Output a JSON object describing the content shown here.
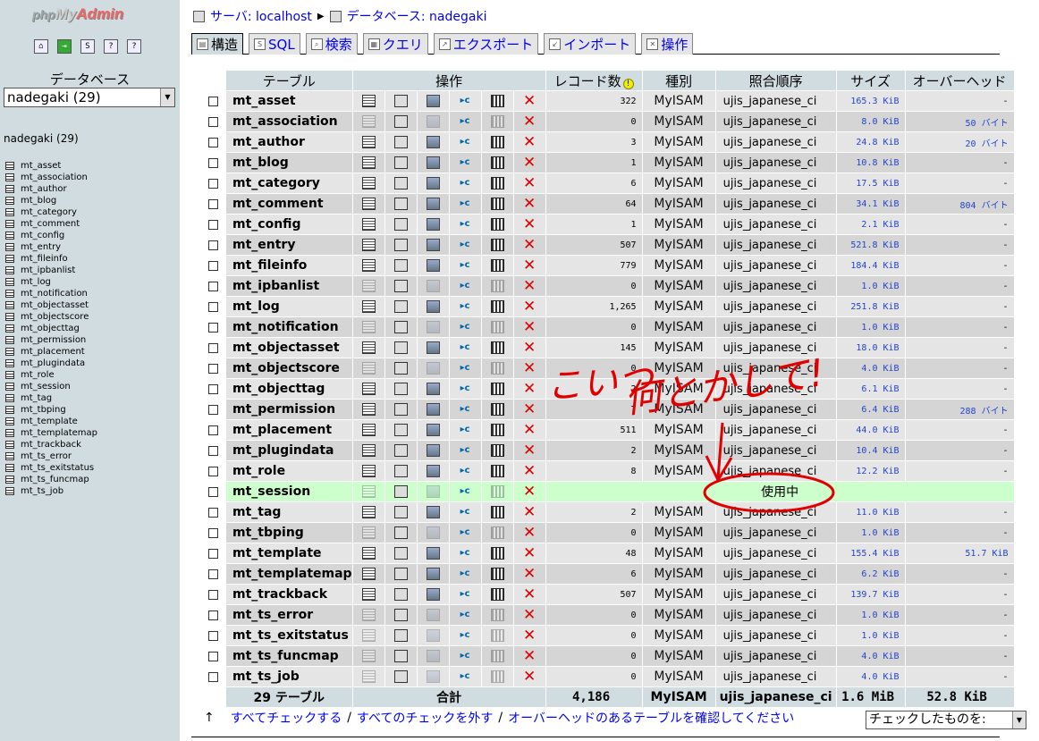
{
  "sidebar": {
    "logo_php": "php",
    "logo_my": "My",
    "logo_admin": "Admin",
    "db_label": "データベース",
    "db_select": "nadegaki (29)",
    "db_name": "nadegaki (29)",
    "tables": [
      "mt_asset",
      "mt_association",
      "mt_author",
      "mt_blog",
      "mt_category",
      "mt_comment",
      "mt_config",
      "mt_entry",
      "mt_fileinfo",
      "mt_ipbanlist",
      "mt_log",
      "mt_notification",
      "mt_objectasset",
      "mt_objectscore",
      "mt_objecttag",
      "mt_permission",
      "mt_placement",
      "mt_plugindata",
      "mt_role",
      "mt_session",
      "mt_tag",
      "mt_tbping",
      "mt_template",
      "mt_templatemap",
      "mt_trackback",
      "mt_ts_error",
      "mt_ts_exitstatus",
      "mt_ts_funcmap",
      "mt_ts_job"
    ]
  },
  "breadcrumb": {
    "server": "サーバ: localhost",
    "database": "データベース: nadegaki"
  },
  "tabs": [
    "構造",
    "SQL",
    "検索",
    "クエリ",
    "エクスポート",
    "インポート",
    "操作"
  ],
  "table_headers": {
    "table": "テーブル",
    "actions": "操作",
    "records": "レコード数",
    "type": "種別",
    "collation": "照合順序",
    "size": "サイズ",
    "overhead": "オーバーヘッド"
  },
  "rows": [
    {
      "name": "mt_asset",
      "records": "322",
      "type": "MyISAM",
      "collation": "ujis_japanese_ci",
      "size": "165.3 KiB",
      "overhead": "-",
      "empty": false
    },
    {
      "name": "mt_association",
      "records": "0",
      "type": "MyISAM",
      "collation": "ujis_japanese_ci",
      "size": "8.0 KiB",
      "overhead": "50 バイト",
      "empty": true
    },
    {
      "name": "mt_author",
      "records": "3",
      "type": "MyISAM",
      "collation": "ujis_japanese_ci",
      "size": "24.8 KiB",
      "overhead": "20 バイト",
      "empty": false
    },
    {
      "name": "mt_blog",
      "records": "1",
      "type": "MyISAM",
      "collation": "ujis_japanese_ci",
      "size": "10.8 KiB",
      "overhead": "-",
      "empty": false
    },
    {
      "name": "mt_category",
      "records": "6",
      "type": "MyISAM",
      "collation": "ujis_japanese_ci",
      "size": "17.5 KiB",
      "overhead": "-",
      "empty": false
    },
    {
      "name": "mt_comment",
      "records": "64",
      "type": "MyISAM",
      "collation": "ujis_japanese_ci",
      "size": "34.1 KiB",
      "overhead": "804 バイト",
      "empty": false
    },
    {
      "name": "mt_config",
      "records": "1",
      "type": "MyISAM",
      "collation": "ujis_japanese_ci",
      "size": "2.1 KiB",
      "overhead": "-",
      "empty": false
    },
    {
      "name": "mt_entry",
      "records": "507",
      "type": "MyISAM",
      "collation": "ujis_japanese_ci",
      "size": "521.8 KiB",
      "overhead": "-",
      "empty": false
    },
    {
      "name": "mt_fileinfo",
      "records": "779",
      "type": "MyISAM",
      "collation": "ujis_japanese_ci",
      "size": "184.4 KiB",
      "overhead": "-",
      "empty": false
    },
    {
      "name": "mt_ipbanlist",
      "records": "0",
      "type": "MyISAM",
      "collation": "ujis_japanese_ci",
      "size": "1.0 KiB",
      "overhead": "-",
      "empty": true
    },
    {
      "name": "mt_log",
      "records": "1,265",
      "type": "MyISAM",
      "collation": "ujis_japanese_ci",
      "size": "251.8 KiB",
      "overhead": "-",
      "empty": false
    },
    {
      "name": "mt_notification",
      "records": "0",
      "type": "MyISAM",
      "collation": "ujis_japanese_ci",
      "size": "1.0 KiB",
      "overhead": "-",
      "empty": true
    },
    {
      "name": "mt_objectasset",
      "records": "145",
      "type": "MyISAM",
      "collation": "ujis_japanese_ci",
      "size": "18.0 KiB",
      "overhead": "-",
      "empty": false
    },
    {
      "name": "mt_objectscore",
      "records": "0",
      "type": "MyISAM",
      "collation": "ujis_japanese_ci",
      "size": "4.0 KiB",
      "overhead": "-",
      "empty": true
    },
    {
      "name": "mt_objecttag",
      "records": "2",
      "type": "MyISAM",
      "collation": "ujis_japanese_ci",
      "size": "6.1 KiB",
      "overhead": "-",
      "empty": false
    },
    {
      "name": "mt_permission",
      "records": "7",
      "type": "MyISAM",
      "collation": "ujis_japanese_ci",
      "size": "6.4 KiB",
      "overhead": "288 バイト",
      "empty": false
    },
    {
      "name": "mt_placement",
      "records": "511",
      "type": "MyISAM",
      "collation": "ujis_japanese_ci",
      "size": "44.0 KiB",
      "overhead": "-",
      "empty": false
    },
    {
      "name": "mt_plugindata",
      "records": "2",
      "type": "MyISAM",
      "collation": "ujis_japanese_ci",
      "size": "10.4 KiB",
      "overhead": "-",
      "empty": false
    },
    {
      "name": "mt_role",
      "records": "8",
      "type": "MyISAM",
      "collation": "ujis_japanese_ci",
      "size": "12.2 KiB",
      "overhead": "-",
      "empty": false
    },
    {
      "name": "mt_session",
      "inuse": true,
      "inuse_label": "使用中",
      "empty": true
    },
    {
      "name": "mt_tag",
      "records": "2",
      "type": "MyISAM",
      "collation": "ujis_japanese_ci",
      "size": "11.0 KiB",
      "overhead": "-",
      "empty": false
    },
    {
      "name": "mt_tbping",
      "records": "0",
      "type": "MyISAM",
      "collation": "ujis_japanese_ci",
      "size": "1.0 KiB",
      "overhead": "-",
      "empty": true
    },
    {
      "name": "mt_template",
      "records": "48",
      "type": "MyISAM",
      "collation": "ujis_japanese_ci",
      "size": "155.4 KiB",
      "overhead": "51.7 KiB",
      "empty": false
    },
    {
      "name": "mt_templatemap",
      "records": "6",
      "type": "MyISAM",
      "collation": "ujis_japanese_ci",
      "size": "6.2 KiB",
      "overhead": "-",
      "empty": false
    },
    {
      "name": "mt_trackback",
      "records": "507",
      "type": "MyISAM",
      "collation": "ujis_japanese_ci",
      "size": "139.7 KiB",
      "overhead": "-",
      "empty": false
    },
    {
      "name": "mt_ts_error",
      "records": "0",
      "type": "MyISAM",
      "collation": "ujis_japanese_ci",
      "size": "1.0 KiB",
      "overhead": "-",
      "empty": true
    },
    {
      "name": "mt_ts_exitstatus",
      "records": "0",
      "type": "MyISAM",
      "collation": "ujis_japanese_ci",
      "size": "1.0 KiB",
      "overhead": "-",
      "empty": true
    },
    {
      "name": "mt_ts_funcmap",
      "records": "0",
      "type": "MyISAM",
      "collation": "ujis_japanese_ci",
      "size": "4.0 KiB",
      "overhead": "-",
      "empty": true
    },
    {
      "name": "mt_ts_job",
      "records": "0",
      "type": "MyISAM",
      "collation": "ujis_japanese_ci",
      "size": "4.0 KiB",
      "overhead": "-",
      "empty": true
    }
  ],
  "footer": {
    "count": "29 テーブル",
    "sum_label": "合計",
    "records": "4,186",
    "type": "MyISAM",
    "collation": "ujis_japanese_ci",
    "size": "1.6 MiB",
    "overhead": "52.8 KiB"
  },
  "links": {
    "check_all": "すべてチェックする",
    "uncheck_all": "すべてのチェックを外す",
    "check_overhead": "オーバーヘッドのあるテーブルを確認してください",
    "separator": "/"
  },
  "with_selected": "チェックしたものを:",
  "annotation": {
    "line1": "こいつ",
    "line2": "何とかして!",
    "color": "#e00000"
  }
}
